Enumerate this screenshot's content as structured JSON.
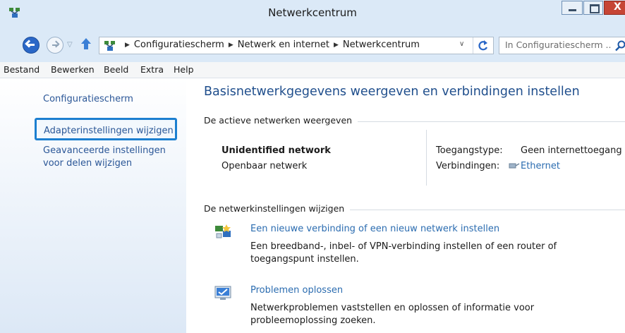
{
  "window": {
    "title": "Netwerkcentrum",
    "accent": "#2a67c7",
    "close_color": "#c64535",
    "buttons": {
      "minimize": "minimize-icon",
      "maximize": "maximize-icon",
      "close_label": "X"
    }
  },
  "address_bar": {
    "breadcrumbs": [
      "Configuratiescherm",
      "Netwerk en internet",
      "Netwerkcentrum"
    ],
    "search_placeholder": "In Configuratiescherm ...",
    "icons": {
      "back": "back-arrow-icon",
      "forward": "forward-arrow-icon",
      "up": "up-arrow-icon",
      "refresh": "refresh-icon",
      "search": "search-icon"
    }
  },
  "menu": {
    "items": [
      "Bestand",
      "Bewerken",
      "Beeld",
      "Extra",
      "Help"
    ]
  },
  "sidebar": {
    "items": [
      {
        "label": "Configuratiescherm"
      },
      {
        "label": "Adapterinstellingen wijzigen",
        "selected": true
      },
      {
        "label": "Geavanceerde instellingen voor delen wijzigen"
      }
    ],
    "selected_border_color": "#1c7fd0"
  },
  "main": {
    "heading": "Basisnetwerkgegevens weergeven en verbindingen instellen",
    "active_section": {
      "label": "De actieve netwerken weergeven",
      "network_name": "Unidentified network",
      "network_type": "Openbaar netwerk",
      "access_type_label": "Toegangstype:",
      "access_type_value": "Geen internettoegang",
      "connections_label": "Verbindingen:",
      "connection_link": "Ethernet"
    },
    "settings_section": {
      "label": "De netwerkinstellingen wijzigen",
      "tasks": [
        {
          "title": "Een nieuwe verbinding of een nieuw netwerk instellen",
          "description": "Een breedband-, inbel- of VPN-verbinding instellen of een router of toegangspunt instellen.",
          "icon": "new-connection-icon"
        },
        {
          "title": "Problemen oplossen",
          "description": "Netwerkproblemen vaststellen en oplossen of informatie voor probleemoplossing zoeken.",
          "icon": "troubleshoot-icon"
        }
      ]
    }
  }
}
